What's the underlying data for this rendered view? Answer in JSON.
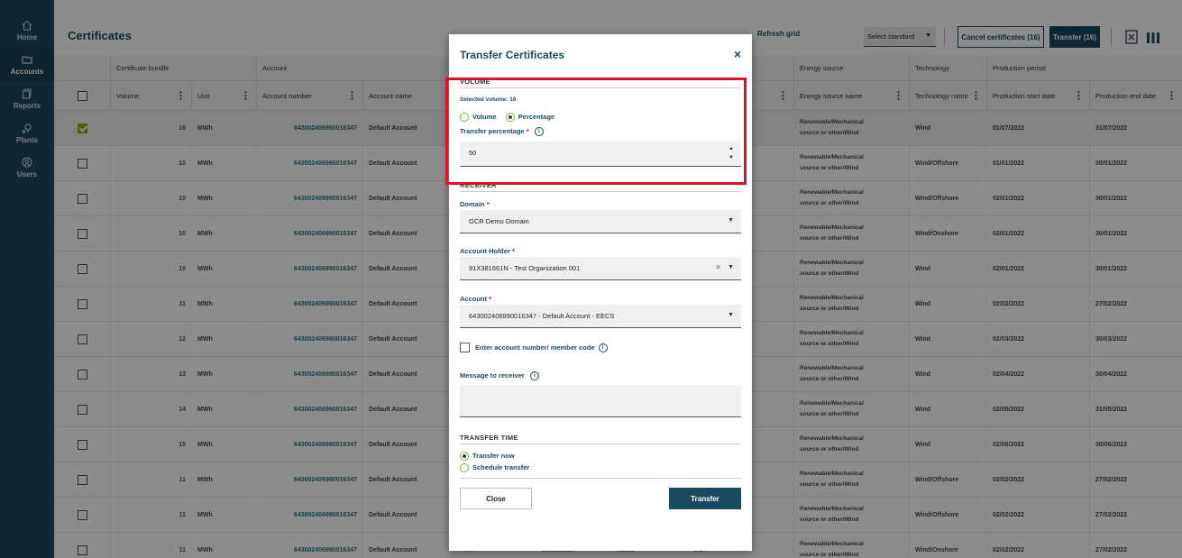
{
  "sidebar": {
    "items": [
      {
        "label": "Home",
        "icon": "home-icon"
      },
      {
        "label": "Accounts",
        "icon": "folder-icon",
        "active": true
      },
      {
        "label": "Reports",
        "icon": "copy-icon"
      },
      {
        "label": "Plants",
        "icon": "plant-icon"
      },
      {
        "label": "Users",
        "icon": "user-icon"
      }
    ]
  },
  "header": {
    "title": "Certificates",
    "refresh_label": "Refresh grid",
    "select_standard": "Select standard",
    "cancel_label": "Cancel certificates (16)",
    "transfer_label": "Transfer (16)"
  },
  "grid": {
    "groups": [
      "Certificate bundle",
      "Account",
      "Energy source",
      "Technology",
      "Production period"
    ],
    "columns": [
      "Volume",
      "Unit",
      "Account number",
      "Account name",
      "Energy source name",
      "Technology name",
      "Production start date",
      "Production end date"
    ],
    "last_row_mid": [
      "FI",
      "18/10/2022",
      "EECS",
      "GO"
    ],
    "rows": [
      {
        "volume": "16",
        "unit": "MWh",
        "account_number": "643002406990016347",
        "account_name": "Default Account",
        "energy": [
          "Renewable/Mechanical",
          "source or other/Wind"
        ],
        "technology": "Wind",
        "start": "01/07/2022",
        "end": "31/07/2022",
        "checked": true
      },
      {
        "volume": "10",
        "unit": "MWh",
        "account_number": "643002406990016347",
        "account_name": "Default Account",
        "energy": [
          "Renewable/Mechanical",
          "source or other/Wind"
        ],
        "technology": "Wind/Offshore",
        "start": "01/01/2022",
        "end": "30/01/2022",
        "checked": false
      },
      {
        "volume": "10",
        "unit": "MWh",
        "account_number": "643002406990016347",
        "account_name": "Default Account",
        "energy": [
          "Renewable/Mechanical",
          "source or other/Wind"
        ],
        "technology": "Wind/Offshore",
        "start": "02/01/2022",
        "end": "30/01/2022",
        "checked": false
      },
      {
        "volume": "10",
        "unit": "MWh",
        "account_number": "643002406990016347",
        "account_name": "Default Account",
        "energy": [
          "Renewable/Mechanical",
          "source or other/Wind"
        ],
        "technology": "Wind/Onshore",
        "start": "02/01/2022",
        "end": "30/01/2022",
        "checked": false
      },
      {
        "volume": "10",
        "unit": "MWh",
        "account_number": "643002406990016347",
        "account_name": "Default Account",
        "energy": [
          "Renewable/Mechanical",
          "source or other/Wind"
        ],
        "technology": "Wind",
        "start": "02/01/2022",
        "end": "30/01/2022",
        "checked": false
      },
      {
        "volume": "11",
        "unit": "MWh",
        "account_number": "643002406990016347",
        "account_name": "Default Account",
        "energy": [
          "Renewable/Mechanical",
          "source or other/Wind"
        ],
        "technology": "Wind",
        "start": "02/02/2022",
        "end": "27/02/2022",
        "checked": false
      },
      {
        "volume": "12",
        "unit": "MWh",
        "account_number": "643002406990016347",
        "account_name": "Default Account",
        "energy": [
          "Renewable/Mechanical",
          "source or other/Wind"
        ],
        "technology": "Wind",
        "start": "02/03/2022",
        "end": "30/03/2022",
        "checked": false
      },
      {
        "volume": "13",
        "unit": "MWh",
        "account_number": "643002406990016347",
        "account_name": "Default Account",
        "energy": [
          "Renewable/Mechanical",
          "source or other/Wind"
        ],
        "technology": "Wind",
        "start": "02/04/2022",
        "end": "30/04/2022",
        "checked": false
      },
      {
        "volume": "14",
        "unit": "MWh",
        "account_number": "643002406990016347",
        "account_name": "Default Account",
        "energy": [
          "Renewable/Mechanical",
          "source or other/Wind"
        ],
        "technology": "Wind",
        "start": "02/05/2022",
        "end": "31/05/2022",
        "checked": false
      },
      {
        "volume": "15",
        "unit": "MWh",
        "account_number": "643002406990016347",
        "account_name": "Default Account",
        "energy": [
          "Renewable/Mechanical",
          "source or other/Wind"
        ],
        "technology": "Wind",
        "start": "02/06/2022",
        "end": "30/06/2022",
        "checked": false
      },
      {
        "volume": "11",
        "unit": "MWh",
        "account_number": "643002406990016347",
        "account_name": "Default Account",
        "energy": [
          "Renewable/Mechanical",
          "source or other/Wind"
        ],
        "technology": "Wind/Offshore",
        "start": "02/02/2022",
        "end": "27/02/2022",
        "checked": false
      },
      {
        "volume": "11",
        "unit": "MWh",
        "account_number": "643002406990016347",
        "account_name": "Default Account",
        "energy": [
          "Renewable/Mechanical",
          "source or other/Wind"
        ],
        "technology": "Wind/Offshore",
        "start": "02/02/2022",
        "end": "27/02/2022",
        "checked": false
      },
      {
        "volume": "11",
        "unit": "MWh",
        "account_number": "643002406990016347",
        "account_name": "Default Account",
        "energy": [
          "Renewable/Mechanical",
          "source or other/Wind"
        ],
        "technology": "Wind/Onshore",
        "start": "02/02/2022",
        "end": "27/02/2022",
        "checked": false
      }
    ]
  },
  "modal": {
    "title": "Transfer Certificates",
    "close_icon": "×",
    "volume_section": "VOLUME",
    "selected_volume": "Selected volume: 16",
    "radio_volume": "Volume",
    "radio_percentage": "Percentage",
    "percentage_label": "Transfer percentage",
    "required_mark": "*",
    "percentage_value": "50",
    "receiver_section": "RECEIVER",
    "domain_label": "Domain",
    "domain_value": "GCR Demo Domain",
    "holder_label": "Account Holder",
    "holder_value": "91X381661N - Test Organization 001",
    "account_label": "Account",
    "account_value": "643002406990016347 - Default Account - EECS",
    "enter_account_label": "Enter account number/ member code",
    "message_label": "Message to receiver",
    "transfer_time_section": "TRANSFER TIME",
    "transfer_now": "Transfer now",
    "schedule_transfer": "Schedule transfer",
    "close_button": "Close",
    "transfer_button": "Transfer"
  },
  "colors": {
    "primary": "#1b4a5e",
    "accent_green": "#7fae2b",
    "highlight_red": "#e0102a"
  }
}
